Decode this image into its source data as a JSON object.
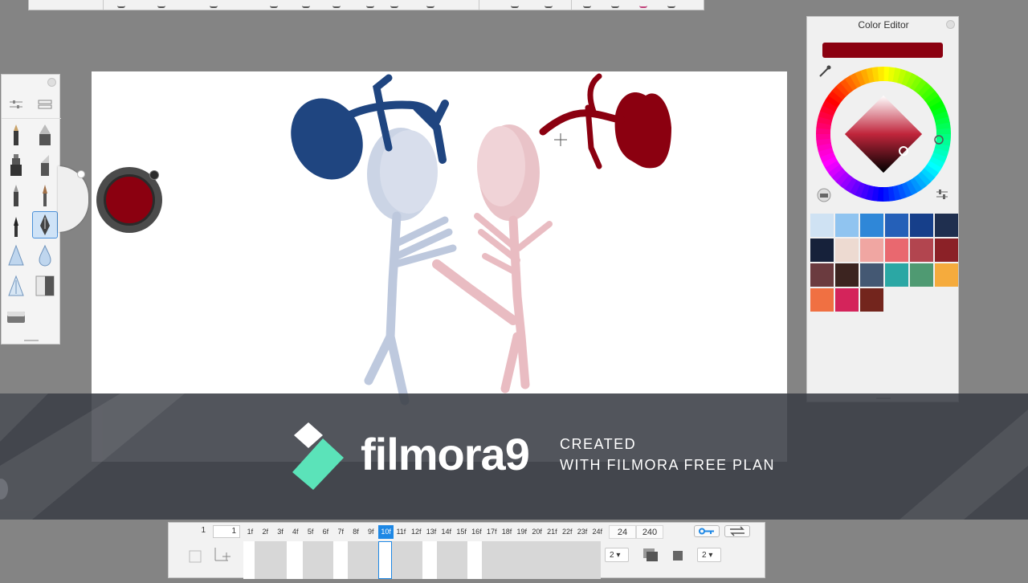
{
  "color_editor": {
    "title": "Color Editor",
    "current_color": "#8b0010",
    "swatches": [
      "#cfe2f3",
      "#90c4f0",
      "#2f87d8",
      "#2560b8",
      "#163f8a",
      "#1f2f4f",
      "#16213a",
      "#eddad1",
      "#f0a6a2",
      "#e9686f",
      "#b2454f",
      "#8b2127",
      "#6b3b3f",
      "#3c2420",
      "#445873",
      "#2ba7a4",
      "#4f9a72",
      "#f5ab3d",
      "#f07042",
      "#d4245b",
      "#73251d"
    ]
  },
  "watermark": {
    "brand": "filmora9",
    "line1": "CREATED",
    "line2": "WITH FILMORA FREE PLAN"
  },
  "timeline": {
    "start_frame": "1",
    "current_start": "1",
    "frames": [
      "1f",
      "2f",
      "3f",
      "4f",
      "5f",
      "6f",
      "7f",
      "8f",
      "9f",
      "10f",
      "11f",
      "12f",
      "13f",
      "14f",
      "15f",
      "16f",
      "17f",
      "18f",
      "19f",
      "20f",
      "21f",
      "22f",
      "23f",
      "24f"
    ],
    "active_frame_index": 9,
    "fps": "24",
    "total_frames": "240",
    "onion_before": "2",
    "onion_after": "2"
  },
  "colors": {
    "accent": "#1e88e5",
    "brush_red": "#8b0010",
    "brush_blue": "#1f4580"
  }
}
